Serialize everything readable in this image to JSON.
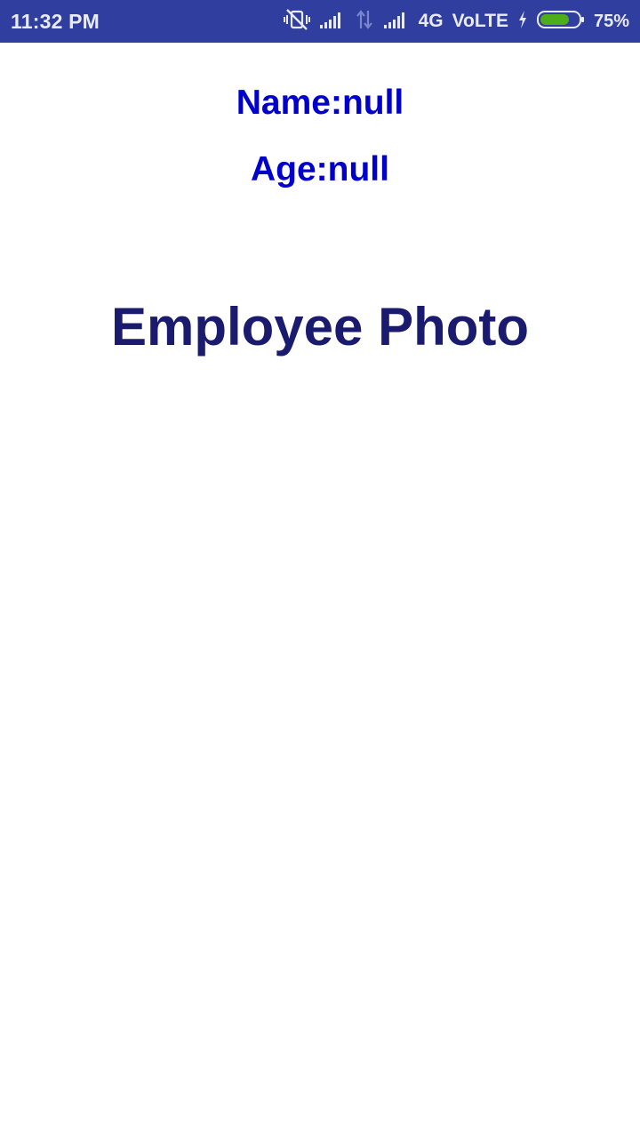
{
  "status_bar": {
    "time": "11:32 PM",
    "network_label": "4G",
    "volte_label": "VoLTE",
    "battery_percent": "75%",
    "battery_level": 0.75,
    "icons": [
      "vibrate-off-icon",
      "signal-icon",
      "data-arrows-icon",
      "signal-icon",
      "charging-icon",
      "battery-icon"
    ],
    "bar_color": "#303f9f",
    "battery_fill_color": "#4caf1a"
  },
  "employee": {
    "name_text": "Name:null",
    "age_text": "Age:null",
    "photo_heading": "Employee Photo"
  },
  "colors": {
    "info_text": "#0000cc",
    "heading_text": "#1a1a6e"
  }
}
